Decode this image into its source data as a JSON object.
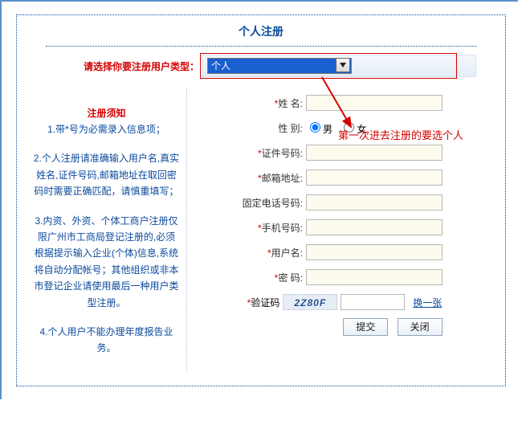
{
  "title": "个人注册",
  "prompt_label": "请选择你要注册用户类型：",
  "user_type_selected": "个人",
  "annotation": "第一次进去注册的要选个人",
  "left": {
    "notice_title": "注册须知",
    "n1": "1.带*号为必需录入信息项；",
    "n2": "2.个人注册请准确输入用户名,真实姓名,证件号码,邮箱地址在取回密码时需要正确匹配，请慎重填写；",
    "n3": "3.内资、外资、个体工商户注册仅限广州市工商局登记注册的,必须根据提示输入企业(个体)信息,系统将自动分配帐号；其他组织或非本市登记企业请使用最后一种用户类型注册。",
    "n4": "4.个人用户不能办理年度报告业务。"
  },
  "form": {
    "name_label": "姓 名:",
    "gender_label": "性 别:",
    "gender_male": "男",
    "gender_female": "女",
    "id_label": "证件号码:",
    "email_label": "邮箱地址:",
    "tel_label": "固定电话号码:",
    "mobile_label": "手机号码:",
    "user_label": "用户名:",
    "pwd_label": "密 码:",
    "captcha_label": "验证码",
    "captcha_value": "2Z80F",
    "captcha_refresh": "换一张",
    "submit": "提交",
    "close": "关闭"
  }
}
